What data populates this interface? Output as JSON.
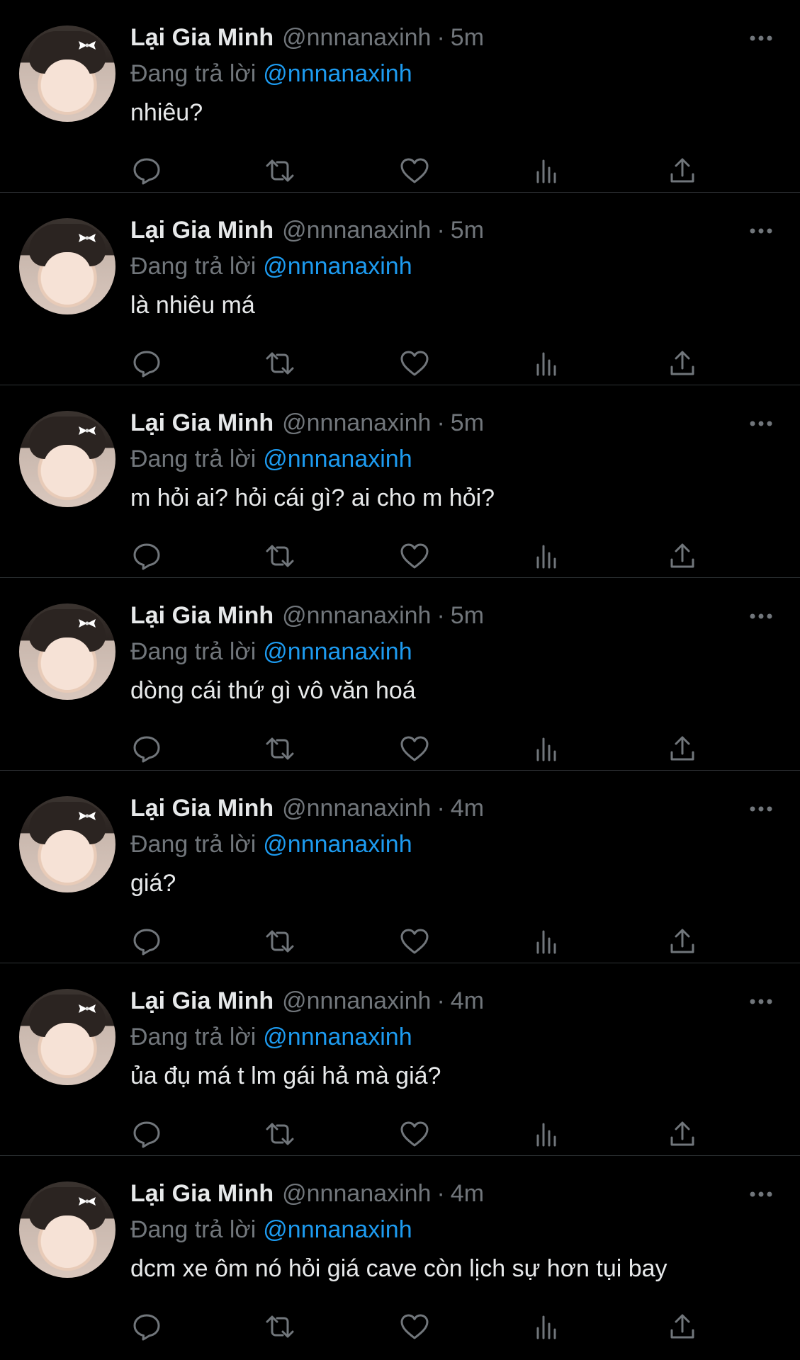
{
  "colors": {
    "background": "#000000",
    "text_primary": "#e7e9ea",
    "text_secondary": "#71767b",
    "mention": "#1d9bf0",
    "divider": "#2f3336"
  },
  "tweets": [
    {
      "name": "Lại Gia Minh",
      "handle": "@nnnanaxinh",
      "separator": "·",
      "time": "5m",
      "reply_prefix": "Đang trả lời",
      "reply_to": "@nnnanaxinh",
      "text": "nhiêu?"
    },
    {
      "name": "Lại Gia Minh",
      "handle": "@nnnanaxinh",
      "separator": "·",
      "time": "5m",
      "reply_prefix": "Đang trả lời",
      "reply_to": "@nnnanaxinh",
      "text": "là nhiêu má"
    },
    {
      "name": "Lại Gia Minh",
      "handle": "@nnnanaxinh",
      "separator": "·",
      "time": "5m",
      "reply_prefix": "Đang trả lời",
      "reply_to": "@nnnanaxinh",
      "text": "m hỏi ai? hỏi cái gì? ai cho m hỏi?"
    },
    {
      "name": "Lại Gia Minh",
      "handle": "@nnnanaxinh",
      "separator": "·",
      "time": "5m",
      "reply_prefix": "Đang trả lời",
      "reply_to": "@nnnanaxinh",
      "text": "dòng cái thứ gì vô văn hoá"
    },
    {
      "name": "Lại Gia Minh",
      "handle": "@nnnanaxinh",
      "separator": "·",
      "time": "4m",
      "reply_prefix": "Đang trả lời",
      "reply_to": "@nnnanaxinh",
      "text": "giá?"
    },
    {
      "name": "Lại Gia Minh",
      "handle": "@nnnanaxinh",
      "separator": "·",
      "time": "4m",
      "reply_prefix": "Đang trả lời",
      "reply_to": "@nnnanaxinh",
      "text": "ủa đụ má t lm gái hả mà giá?"
    },
    {
      "name": "Lại Gia Minh",
      "handle": "@nnnanaxinh",
      "separator": "·",
      "time": "4m",
      "reply_prefix": "Đang trả lời",
      "reply_to": "@nnnanaxinh",
      "text": "dcm xe ôm nó hỏi giá cave còn lịch sự hơn tụi bay"
    }
  ],
  "icons": {
    "avatar": "profile-avatar",
    "more": "more-horizontal-icon",
    "reply": "reply-icon",
    "retweet": "retweet-icon",
    "like": "heart-icon",
    "views": "views-icon",
    "share": "share-icon"
  }
}
